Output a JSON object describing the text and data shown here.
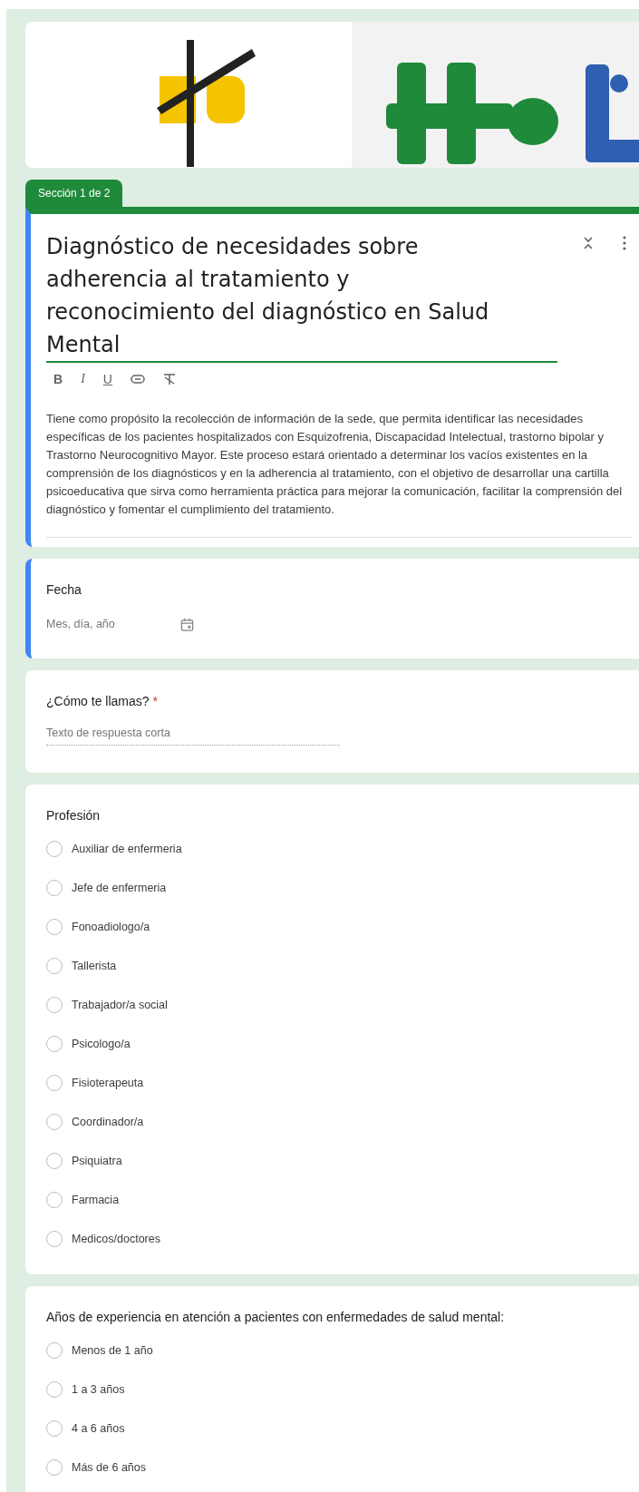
{
  "section_tab": "Sección 1 de 2",
  "header": {
    "focused": true,
    "title": "Diagnóstico de necesidades sobre adherencia al tratamiento y reconocimiento del diagnóstico en Salud Mental",
    "format_buttons": [
      "B",
      "I",
      "U"
    ],
    "description": "Tiene como propósito la recolección de información de la sede, que permita identificar las necesidades específicas de los pacientes hospitalizados con Esquizofrenia, Discapacidad Intelectual, trastorno bipolar y Trastorno Neurocognitivo Mayor. Este proceso estará orientado a determinar los vacíos existentes en la comprensión de los diagnósticos y en la adherencia al tratamiento, con el objetivo de desarrollar una cartilla psicoeducativa que sirva como herramienta práctica para mejorar la comunicación, facilitar la comprensión del diagnóstico y fomentar el cumplimiento del tratamiento."
  },
  "questions": [
    {
      "kind": "date",
      "focused": true,
      "label": "Fecha",
      "placeholder": "Mes, día, año"
    },
    {
      "kind": "short_text",
      "focused": false,
      "label": "¿Cómo te llamas?",
      "required_mark": "*",
      "placeholder": "Texto de respuesta corta"
    },
    {
      "kind": "radio",
      "focused": false,
      "label": "Profesión",
      "options": [
        {
          "label": "Auxiliar de enfermeria",
          "selected": false
        },
        {
          "label": "Jefe de enfermeria",
          "selected": false
        },
        {
          "label": "Fonoadiologo/a",
          "selected": false
        },
        {
          "label": "Tallerista",
          "selected": false
        },
        {
          "label": "Trabajador/a social",
          "selected": false
        },
        {
          "label": "Psicologo/a",
          "selected": false
        },
        {
          "label": "Fisioterapeuta",
          "selected": false
        },
        {
          "label": "Coordinador/a",
          "selected": false
        },
        {
          "label": "Psiquiatra",
          "selected": false
        },
        {
          "label": "Farmacia",
          "selected": false
        },
        {
          "label": "Medicos/doctores",
          "selected": false
        }
      ]
    },
    {
      "kind": "radio",
      "focused": false,
      "label": "Años de experiencia en atención a pacientes con enfermedades de salud mental:",
      "options": [
        {
          "label": "Menos de 1 año",
          "selected": false
        },
        {
          "label": "1 a 3 años",
          "selected": false
        },
        {
          "label": "4 a 6 años",
          "selected": false
        },
        {
          "label": "Más de 6 años",
          "selected": false
        }
      ]
    }
  ]
}
